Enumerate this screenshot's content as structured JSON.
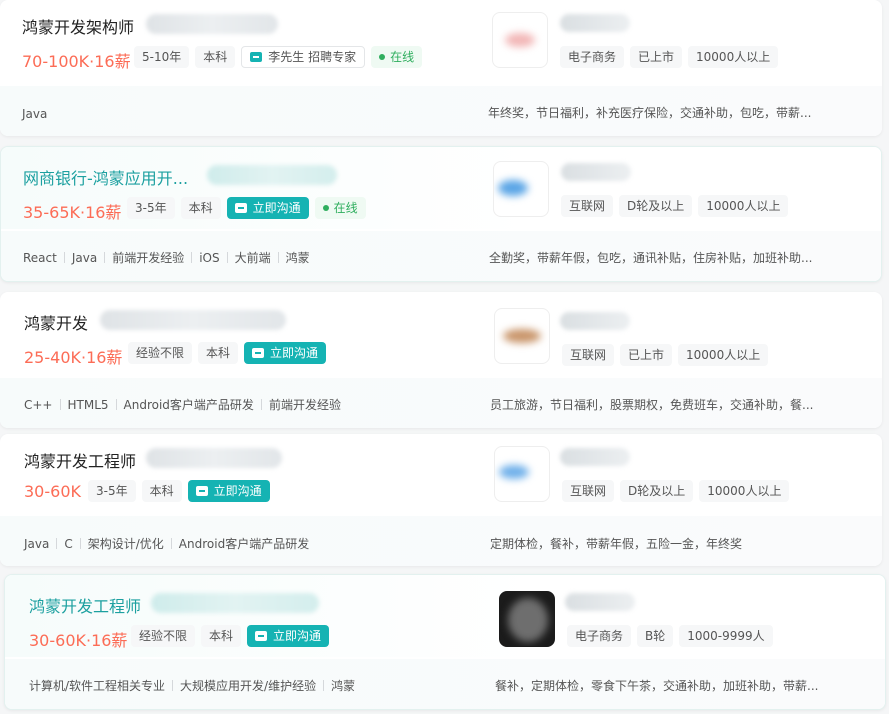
{
  "jobs": [
    {
      "title": "鸿蒙开发架构师",
      "salary": "70-100K·16薪",
      "experience": "5-10年",
      "degree": "本科",
      "recruiter": "李先生 招聘专家",
      "status": "在线",
      "company_tags": [
        "电子商务",
        "已上市",
        "10000人以上"
      ],
      "skills": [
        "Java"
      ],
      "welfare": "年终奖，节日福利，补充医疗保险，交通补助，包吃，带薪..."
    },
    {
      "title": "网商银行-鸿蒙应用开...",
      "salary": "35-65K·16薪",
      "experience": "3-5年",
      "degree": "本科",
      "chat": "立即沟通",
      "status": "在线",
      "company_tags": [
        "互联网",
        "D轮及以上",
        "10000人以上"
      ],
      "skills": [
        "React",
        "Java",
        "前端开发经验",
        "iOS",
        "大前端",
        "鸿蒙"
      ],
      "welfare": "全勤奖，带薪年假，包吃，通讯补贴，住房补贴，加班补助..."
    },
    {
      "title": "鸿蒙开发",
      "salary": "25-40K·16薪",
      "experience": "经验不限",
      "degree": "本科",
      "chat": "立即沟通",
      "company_tags": [
        "互联网",
        "已上市",
        "10000人以上"
      ],
      "skills": [
        "C++",
        "HTML5",
        "Android客户端产品研发",
        "前端开发经验"
      ],
      "welfare": "员工旅游，节日福利，股票期权，免费班车，交通补助，餐..."
    },
    {
      "title": "鸿蒙开发工程师",
      "salary": "30-60K",
      "experience": "3-5年",
      "degree": "本科",
      "chat": "立即沟通",
      "company_tags": [
        "互联网",
        "D轮及以上",
        "10000人以上"
      ],
      "skills": [
        "Java",
        "C",
        "架构设计/优化",
        "Android客户端产品研发"
      ],
      "welfare": "定期体检，餐补，带薪年假，五险一金，年终奖"
    },
    {
      "title": "鸿蒙开发工程师",
      "salary": "30-60K·16薪",
      "experience": "经验不限",
      "degree": "本科",
      "chat": "立即沟通",
      "company_tags": [
        "电子商务",
        "B轮",
        "1000-9999人"
      ],
      "skills": [
        "计算机/软件工程相关专业",
        "大规模应用开发/维护经验",
        "鸿蒙"
      ],
      "welfare": "餐补，定期体检，零食下午茶，交通补助，加班补助，带薪..."
    }
  ],
  "colors": {
    "salary": "#fc6c56",
    "accent_teal": "#15b3b3",
    "title_teal": "#1ca0a0",
    "online_green": "#2fae5e"
  },
  "icons": {
    "chat": "chat-bubble-icon",
    "online": "online-dot-icon"
  }
}
